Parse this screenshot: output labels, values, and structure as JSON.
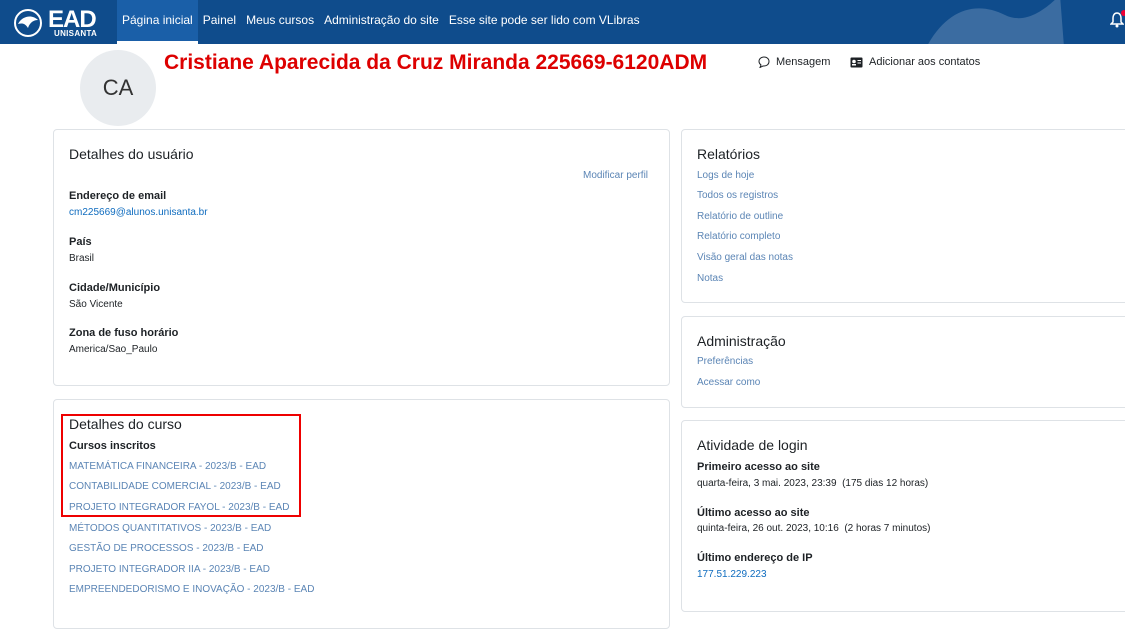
{
  "brand": {
    "logo_text": "EAD",
    "logo_sub": "UNISANTA"
  },
  "nav": [
    {
      "label": "Página inicial",
      "active": true
    },
    {
      "label": "Painel"
    },
    {
      "label": "Meus cursos"
    },
    {
      "label": "Administração do site"
    },
    {
      "label": "Esse site pode ser lido com VLibras"
    }
  ],
  "profile": {
    "initials": "CA",
    "name": "Cristiane Aparecida da Cruz Miranda 225669-6120ADM",
    "message_label": "Mensagem",
    "add_contact_label": "Adicionar aos contatos"
  },
  "user_details": {
    "title": "Detalhes do usuário",
    "edit_link": "Modificar perfil",
    "email_label": "Endereço de email",
    "email_value": "cm225669@alunos.unisanta.br",
    "country_label": "País",
    "country_value": "Brasil",
    "city_label": "Cidade/Município",
    "city_value": "São Vicente",
    "timezone_label": "Zona de fuso horário",
    "timezone_value": "America/Sao_Paulo"
  },
  "course_details": {
    "title": "Detalhes do curso",
    "enrolled_label": "Cursos inscritos",
    "courses": [
      "MATEMÁTICA FINANCEIRA - 2023/B - EAD",
      "CONTABILIDADE COMERCIAL - 2023/B - EAD",
      "PROJETO INTEGRADOR FAYOL - 2023/B - EAD",
      "MÉTODOS QUANTITATIVOS - 2023/B - EAD",
      "GESTÃO DE PROCESSOS - 2023/B - EAD",
      "PROJETO INTEGRADOR IIA - 2023/B - EAD",
      "EMPREENDEDORISMO E INOVAÇÃO - 2023/B - EAD"
    ]
  },
  "reports": {
    "title": "Relatórios",
    "links": [
      "Logs de hoje",
      "Todos os registros",
      "Relatório de outline",
      "Relatório completo",
      "Visão geral das notas",
      "Notas"
    ]
  },
  "administration": {
    "title": "Administração",
    "links": [
      "Preferências",
      "Acessar como"
    ]
  },
  "login_activity": {
    "title": "Atividade de login",
    "first_access_label": "Primeiro acesso ao site",
    "first_access_value": "quarta-feira, 3 mai. 2023, 23:39  (175 dias 12 horas)",
    "last_access_label": "Último acesso ao site",
    "last_access_value": "quinta-feira, 26 out. 2023, 10:16  (2 horas 7 minutos)",
    "last_ip_label": "Último endereço de IP",
    "last_ip_value": "177.51.229.223"
  },
  "colors": {
    "navbar": "#0f4c8c",
    "link": "#0f6cbf",
    "name": "#dd0000",
    "highlight_box": "#ee0000"
  }
}
